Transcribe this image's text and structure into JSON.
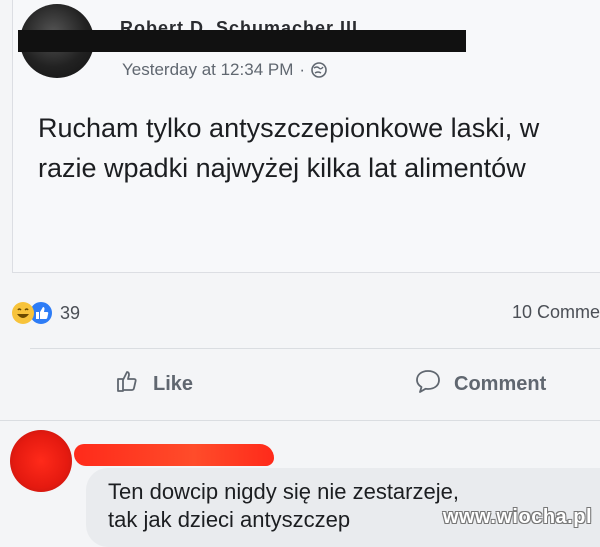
{
  "post": {
    "author": "Robert D. Schumacher III",
    "timestamp": "Yesterday at 12:34 PM",
    "separator": "·",
    "privacy_icon": "globe-icon",
    "text": "Rucham tylko antyszczepionkowe laski, w razie wpadki najwyżej kilka lat alimentów"
  },
  "reactions": {
    "icons": [
      "haha-icon",
      "like-icon"
    ],
    "count": "39",
    "comments": "10 Comme"
  },
  "actions": {
    "like_label": "Like",
    "comment_label": "Comment"
  },
  "comment": {
    "text_line1": "Ten dowcip nigdy się nie zestarzeje,",
    "text_line2": "tak jak dzieci antyszczep"
  },
  "watermark": "www.wiocha.pl",
  "colors": {
    "meta_gray": "#606770",
    "like_blue": "#2d7cf6",
    "haha_yellow": "#f7c33b",
    "redaction_red": "#ff2a1a"
  }
}
